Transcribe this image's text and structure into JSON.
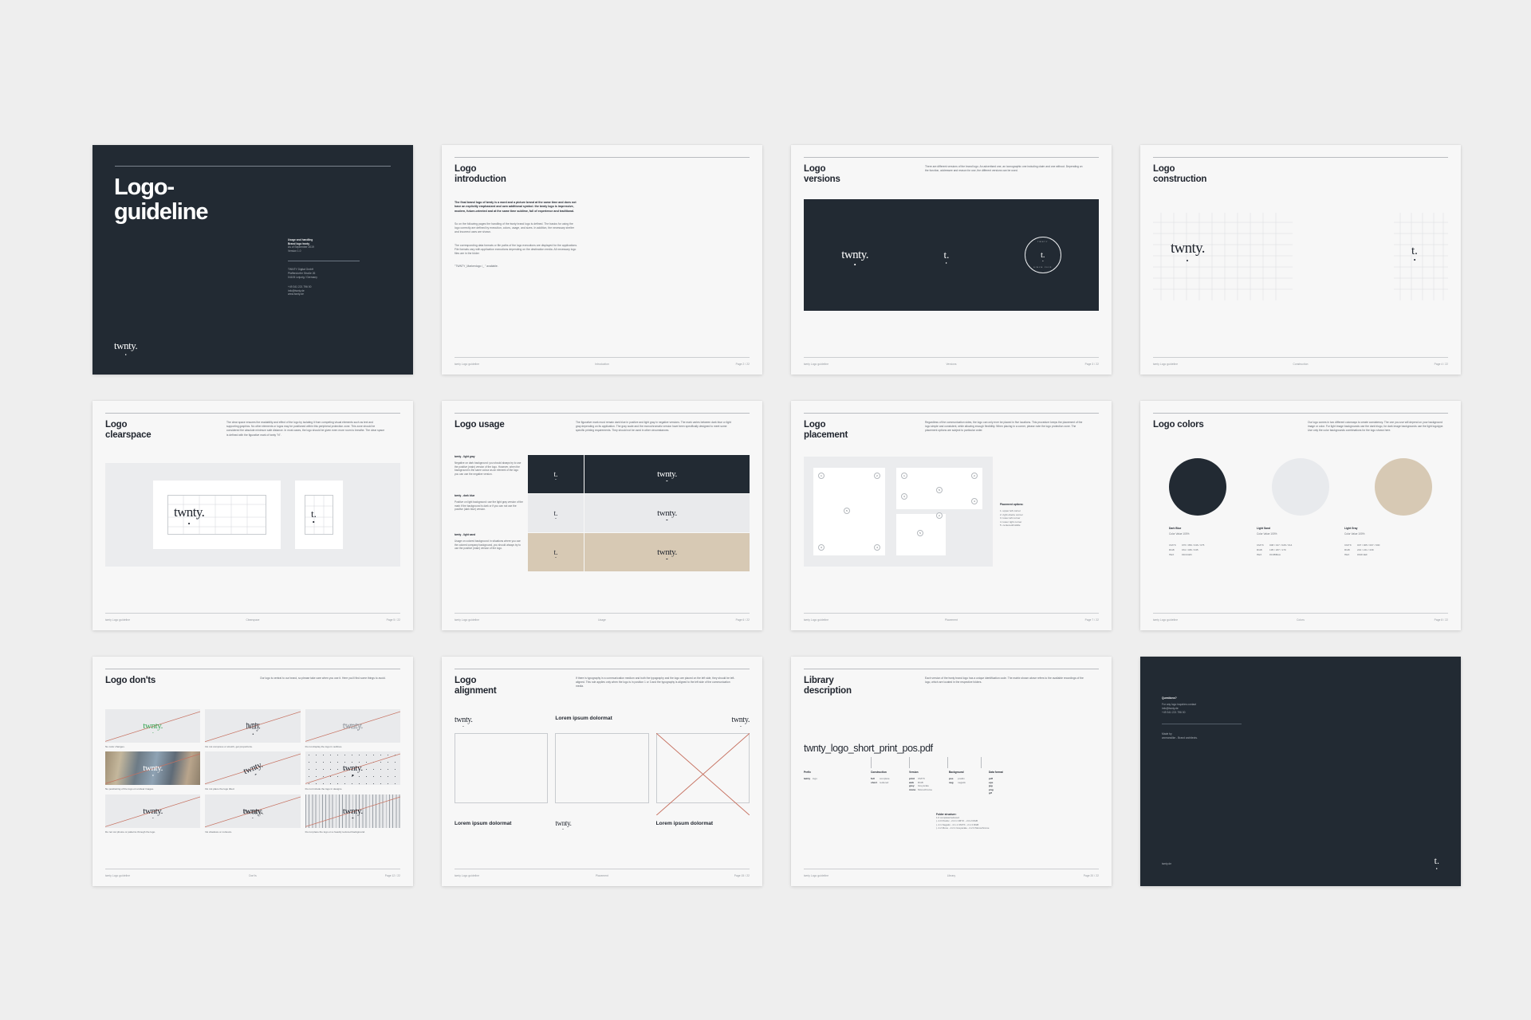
{
  "brand": {
    "wordmark": "twnty.",
    "mark": "t.",
    "colors": {
      "dark_blue": "#222a33",
      "light_sand": "#d7c9b4",
      "light_gray": "#e9eaec",
      "page_bg": "#eeeeee",
      "slide_bg": "#f7f7f7",
      "slash_red": "#c6705f"
    }
  },
  "slides": [
    {
      "id": "cover",
      "title_line1": "Logo-",
      "title_line2": "guideline",
      "meta_line1": "Usage and handling",
      "meta_line2": "Brand logo twnty.",
      "meta_line3": "As of September 2019",
      "meta_line4": "Version 1.0",
      "address_line1": "TWNTY Digital GmbH",
      "address_line2": "Pfaffendorfer Straße 26",
      "address_line3": "04105 Leipzig / Germany",
      "contact_line1": "+49 341 221 796 00",
      "contact_line2": "info@twnty.de",
      "contact_line3": "www.twnty.de"
    },
    {
      "id": "introduction",
      "title_line1": "Logo",
      "title_line2": "introduction",
      "lead": "The final brand logo of twnty is a word and a picture brand at the same time and does not have an explicitly emphasized and own additional symbol. the twnty logo is impressive, modern, future-oriented and at the same time sublime, full of experience and traditional.",
      "para1": "So on the following pages the handling of the twnty brand logo is defined. The basics for using the logo correctly are defined by execution, colors, usage, and sizes. In addition, the necessary shelter and incorrect uses are shown.",
      "para2": "The corresponding data formats or file paths of the logo executions are displayed for the applications. File formats vary with application executions depending on the destination media. All necessary logo files are in the folder",
      "para3": "\"TWNTY_Markenlogo /_ \" available.",
      "footer_left": "twnty Logo guideline",
      "footer_mid": "Introduction",
      "footer_right": "Page 2 / 22"
    },
    {
      "id": "versions",
      "title_line1": "Logo",
      "title_line2": "versions",
      "intro": "There are different versions of the brand logo. An advertised one, an iconographic one including claim and one without. Depending on the function, addressee and reason for use, the different versions can be used.",
      "badge_top": "TWNTY",
      "badge_bottom": "SINCE 2019",
      "footer_left": "twnty Logo guideline",
      "footer_mid": "Versions",
      "footer_right": "Page 3 / 22"
    },
    {
      "id": "construction",
      "title_line1": "Logo",
      "title_line2": "construction",
      "footer_left": "twnty Logo guideline",
      "footer_mid": "Construction",
      "footer_right": "Page 4 / 22"
    },
    {
      "id": "clearspace",
      "title_line1": "Logo",
      "title_line2": "clearspace",
      "intro": "The clear space ensures the readability and effect of the logo by isolating it from competing visual elements such as text and supporting graphics. No other elements or logos may be positioned within this peripheral protection zone. This zone should be considered the absolute minimum safe distance. In most cases, the logo should be given even more room to breathe. The clear space is defined with the figurative mark of twnty \"N\".",
      "footer_left": "twnty Logo guideline",
      "footer_mid": "Clearspace",
      "footer_right": "Page 5 / 22"
    },
    {
      "id": "usage",
      "title_line1": "Logo usage",
      "intro": "The figurative mark must remain dark blue in positive and light gray in negative versions. The mark varies between dark blue or light gray depending on its application. The gray scale and the monochromatic version have been specifically designed to meet some specific printing requirements. They should not be used in other circumstances.",
      "rows": [
        {
          "label": "twnty - light gray",
          "text": "Negative on dark background: you should always try to use the positive (main) version of the logo. However, when the background is the same colour as an element of the logo you can use the negative version."
        },
        {
          "label": "twnty - dark blue",
          "text": "Positive on light background: use the light gray version of the mark if the background is dark or if you can not use the positive (dark blue) version."
        },
        {
          "label": "twnty - light sand",
          "text": "Usage on colored background: in situations where you use the colored company background, you should always try to use the positive (main) version of the logo."
        }
      ],
      "footer_left": "twnty Logo guideline",
      "footer_mid": "Usage",
      "footer_right": "Page 6 / 22"
    },
    {
      "id": "placement",
      "title_line1": "Logo",
      "title_line2": "placement",
      "intro": "Regardless of the communication sides, the logo can only ever be placed in five locations. This procedure keeps the placement of the logo simple and consistent, while allowing enough flexibility. When placing in a corner, please note the logo protection zone. The placement options are subject to particular order.",
      "options_title": "Placement options:",
      "options": [
        "1. upper left corner",
        "2. right oberte corner",
        "3. lower left corner",
        "4. lower right corner",
        "5. centered/middle"
      ],
      "footer_left": "twnty Logo guideline",
      "footer_mid": "Placement",
      "footer_right": "Page 7 / 22"
    },
    {
      "id": "colors",
      "title_line1": "Logo colors",
      "intro": "Our logo comes in two different colorways to create consistency. The one you use will depend on your background image or color. For light image backgrounds use the dark blogo, for dark image backgrounds use the light logotype. Use only the color backgrounds combinations for the logo shown here.",
      "swatches": [
        {
          "name": "Dark Blue",
          "value_label": "Color Value 100%",
          "hexcolor": "#222a33",
          "cmyk": "076 / 059 / 046 / 075",
          "rgb": "031 / 036 / 045",
          "hex": "#1F242D"
        },
        {
          "name": "Light Sand",
          "value_label": "Color Value 100%",
          "hexcolor": "#e8eaed",
          "cmyk": "008 / 017 / 028 / 014",
          "rgb": "195 / 187 / 170",
          "hex": "#C3BBAA"
        },
        {
          "name": "Light Gray",
          "value_label": "Color Value 100%",
          "hexcolor": "#d7c9b4",
          "cmyk": "007 / 005 / 007 / 000",
          "rgb": "242 / 241 / 239",
          "hex": "#F2F1EF"
        }
      ],
      "labels": {
        "cmyk": "CMYK",
        "rgb": "RGB",
        "hex": "HEX"
      },
      "footer_left": "twnty Logo guideline",
      "footer_mid": "Colors",
      "footer_right": "Page 8 / 22"
    },
    {
      "id": "donts",
      "title_line1": "Logo don'ts",
      "intro": "Our logo is central to our brand, so please take care when you use it. Here you'll find some things to avoid.",
      "items": [
        {
          "caption": "No color changes.",
          "variant": "green"
        },
        {
          "caption": "Do not compress or stretch, get proportions.",
          "variant": "squish"
        },
        {
          "caption": "Do not display the logo in outlines.",
          "variant": "outline"
        },
        {
          "caption": "No positioning of the logo on unclear images.",
          "variant": "photo"
        },
        {
          "caption": "Do not place the logo tilted.",
          "variant": "tilt"
        },
        {
          "caption": "Do not include the logo in designs.",
          "variant": "dots"
        },
        {
          "caption": "Do not cut photos or patterns through the logo.",
          "variant": "plain"
        },
        {
          "caption": "No shadows or contours.",
          "variant": "shadow"
        },
        {
          "caption": "Do not place the logo on a heavily textured background.",
          "variant": "stripes"
        }
      ],
      "footer_left": "twnty Logo guideline",
      "footer_mid": "Don'ts",
      "footer_right": "Page 12 / 22"
    },
    {
      "id": "alignment",
      "title_line1": "Logo",
      "title_line2": "alignment",
      "intro": "If there is typography in a communication medium and both the typography and the logo are placed on the left side, they should be left-aligned. This rule applies only when the logo is in position 1 or 3 and the typography is aligned to the left side of the communication media.",
      "col1_bottom": "Lorem ipsum dolormat",
      "col2_top": "Lorem ipsum dolormat",
      "col3_bottom": "Lorem ipsum dolormat",
      "footer_left": "twnty Logo guideline",
      "footer_mid": "Placement",
      "footer_right": "Page 15 / 22"
    },
    {
      "id": "library",
      "title_line1": "Library",
      "title_line2": "description",
      "intro": "Each version of the twnty brand logo has a unique identification code. The matrix shown above refers to the available recordings of the logo, which are located in the respective folders.",
      "filename": "twnty_logo_short_print_pos.pdf",
      "columns": [
        {
          "header": "Prefix",
          "rows": [
            {
              "k": "twnty",
              "v": "logo"
            }
          ]
        },
        {
          "header": "Construction",
          "rows": [
            {
              "k": "full",
              "v": "complete"
            },
            {
              "k": "short",
              "v": "reduced"
            }
          ]
        },
        {
          "header": "Version",
          "rows": [
            {
              "k": "print",
              "v": "CMYK"
            },
            {
              "k": "web",
              "v": "RGB"
            },
            {
              "k": "grey",
              "v": "Greyscale"
            },
            {
              "k": "mono",
              "v": "Monochrome"
            }
          ]
        },
        {
          "header": "Background",
          "rows": [
            {
              "k": "pos",
              "v": "positiv"
            },
            {
              "k": "neg",
              "v": "negativ"
            }
          ]
        },
        {
          "header": "Data format",
          "rows": [
            {
              "k": "pdf",
              "v": ""
            },
            {
              "k": "eps",
              "v": ""
            },
            {
              "k": "jpg",
              "v": ""
            },
            {
              "k": "png",
              "v": ""
            },
            {
              "k": "gif",
              "v": ""
            }
          ]
        }
      ],
      "folder_title": "Folder structure:",
      "folder_lines": [
        "1.0  complete/reduced",
        "|- 2.0 Positiv - 2.0.1 CMYK - 2.0.2 RGB",
        "|- 2.1 Negativ - 2.1.1 CMYK - 2.1.3 RGB",
        "|- 2.2 Mono - 2.2.1 Greyscale - 2.2.3 Monochrome"
      ],
      "footer_left": "twnty Logo guideline",
      "footer_mid": "Library",
      "footer_right": "Page 20 / 22"
    },
    {
      "id": "back",
      "question": "Questions?",
      "contact_line1": "For any logo inquiries contact",
      "contact_line2": "info@twnty.de",
      "contact_line3": "+49 341 221 796 00",
      "made_label": "Made by",
      "made_value": "womanslike - Brand architects.",
      "url": "twnty.de"
    }
  ]
}
